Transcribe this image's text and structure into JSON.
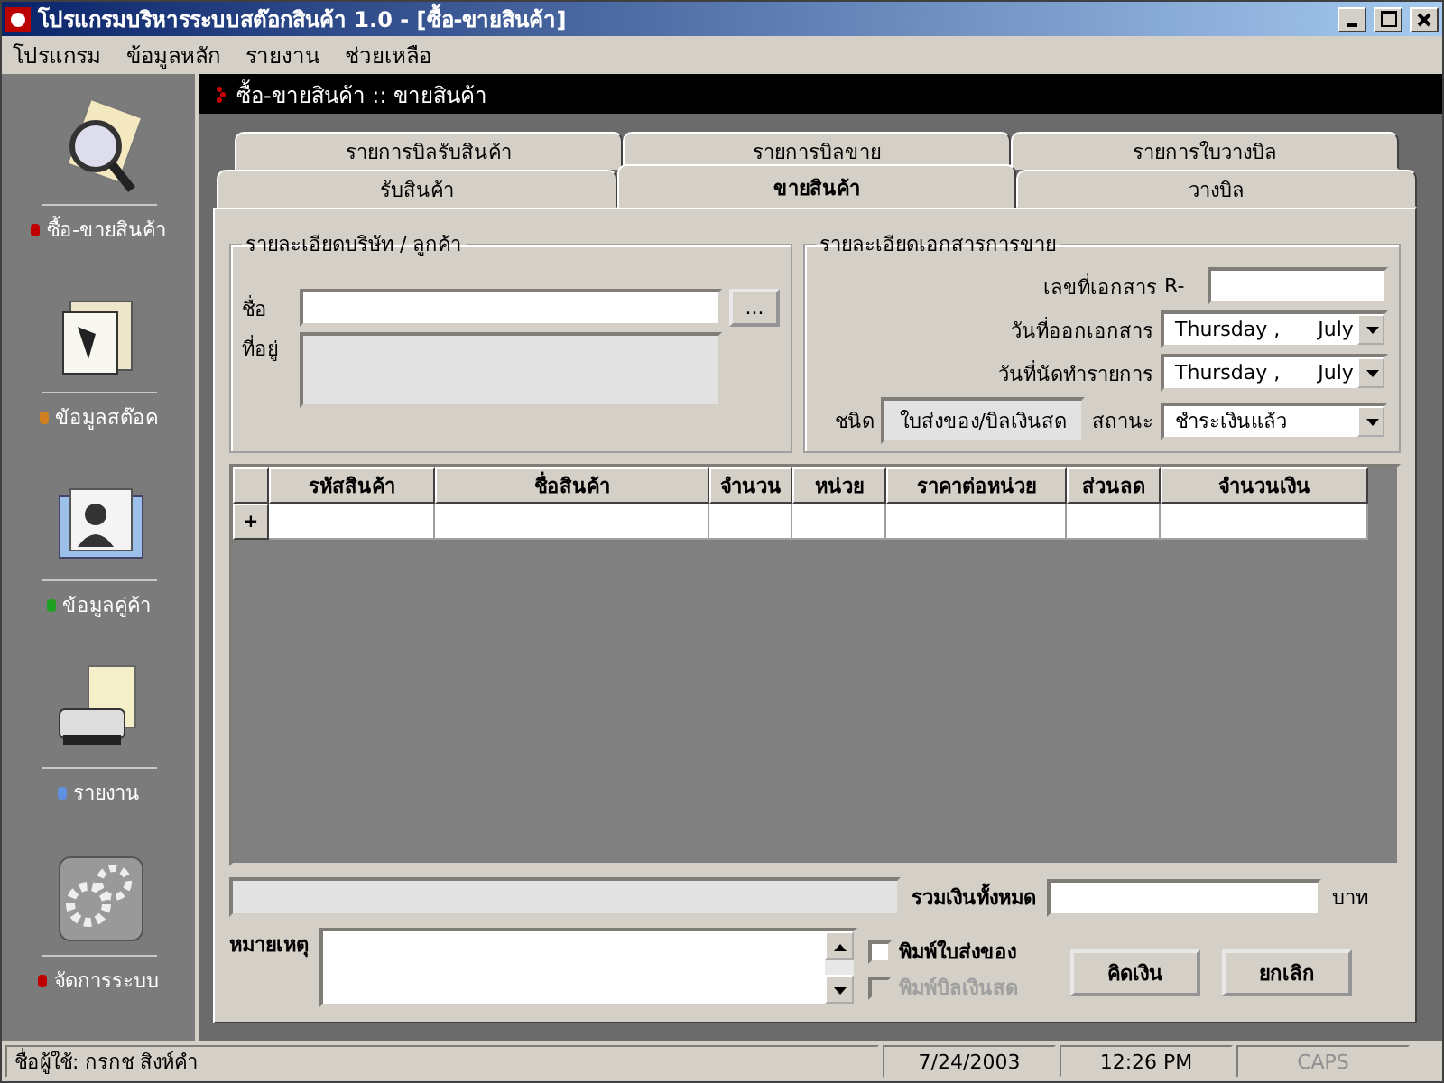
{
  "window": {
    "title": "โปรแกรมบริหารระบบสต๊อกสินค้า 1.0 - [ซื้อ-ขายสินค้า]"
  },
  "menu": [
    "โปรแกรม",
    "ข้อมูลหลัก",
    "รายงาน",
    "ช่วยเหลือ"
  ],
  "sidebar": {
    "items": [
      {
        "kind": "search",
        "label": "ซื้อ-ขายสินค้า",
        "color": "#c00000"
      },
      {
        "kind": "docs",
        "label": "ข้อมูลสต๊อค",
        "color": "#d08020"
      },
      {
        "kind": "folder",
        "label": "ข้อมูลคู่ค้า",
        "color": "#20a020"
      },
      {
        "kind": "printer",
        "label": "รายงาน",
        "color": "#6090e0"
      },
      {
        "kind": "gears",
        "label": "จัดการระบบ",
        "color": "#c00000"
      }
    ]
  },
  "header": {
    "title": "ซื้อ-ขายสินค้า :: ขายสินค้า"
  },
  "tabs_back": [
    {
      "label": "รายการบิลรับสินค้า",
      "selected": false
    },
    {
      "label": "รายการบิลขาย",
      "selected": false
    },
    {
      "label": "รายการใบวางบิล",
      "selected": false
    }
  ],
  "tabs_front": [
    {
      "label": "รับสินค้า",
      "selected": false
    },
    {
      "label": "ขายสินค้า",
      "selected": true
    },
    {
      "label": "วางบิล",
      "selected": false
    }
  ],
  "customer": {
    "title": "รายละเอียดบริษัท / ลูกค้า",
    "name_label": "ชื่อ",
    "browse_button": "...",
    "address_label": "ที่อยู่"
  },
  "document": {
    "title": "รายละเอียดเอกสารการขาย",
    "number_label": "เลขที่เอกสาร",
    "number_prefix": "R-",
    "issue_label": "วันที่ออกเอกสาร",
    "issue_value": "Thursday ,      July",
    "due_label": "วันที่นัดทำรายการ",
    "due_value": "Thursday ,      July",
    "type_label": "ชนิด",
    "type_value": "ใบส่งของ/บิลเงินสด",
    "status_label": "สถานะ",
    "status_value": "ชำระเงินแล้ว"
  },
  "table": {
    "columns": [
      "รหัสสินค้า",
      "ชื่อสินค้า",
      "จำนวน",
      "หน่วย",
      "ราคาต่อหน่วย",
      "ส่วนลด",
      "จำนวนเงิน"
    ],
    "new_row_marker": "+"
  },
  "totals": {
    "label": "รวมเงินทั้งหมด",
    "unit": "บาท"
  },
  "notes": {
    "label": "หมายเหตุ"
  },
  "options": [
    {
      "label": "พิมพ์ใบส่งของ",
      "checked": false,
      "disabled": false
    },
    {
      "label": "พิมพ์บิลเงินสด",
      "checked": false,
      "disabled": true
    }
  ],
  "buttons": [
    "คิดเงิน",
    "ยกเลิก"
  ],
  "status_bar": {
    "user": "ชื่อผู้ใช้: กรกช สิงห์คำ",
    "date": "7/24/2003",
    "time": "12:26 PM",
    "caps": {
      "label": "CAPS",
      "on": false
    }
  }
}
